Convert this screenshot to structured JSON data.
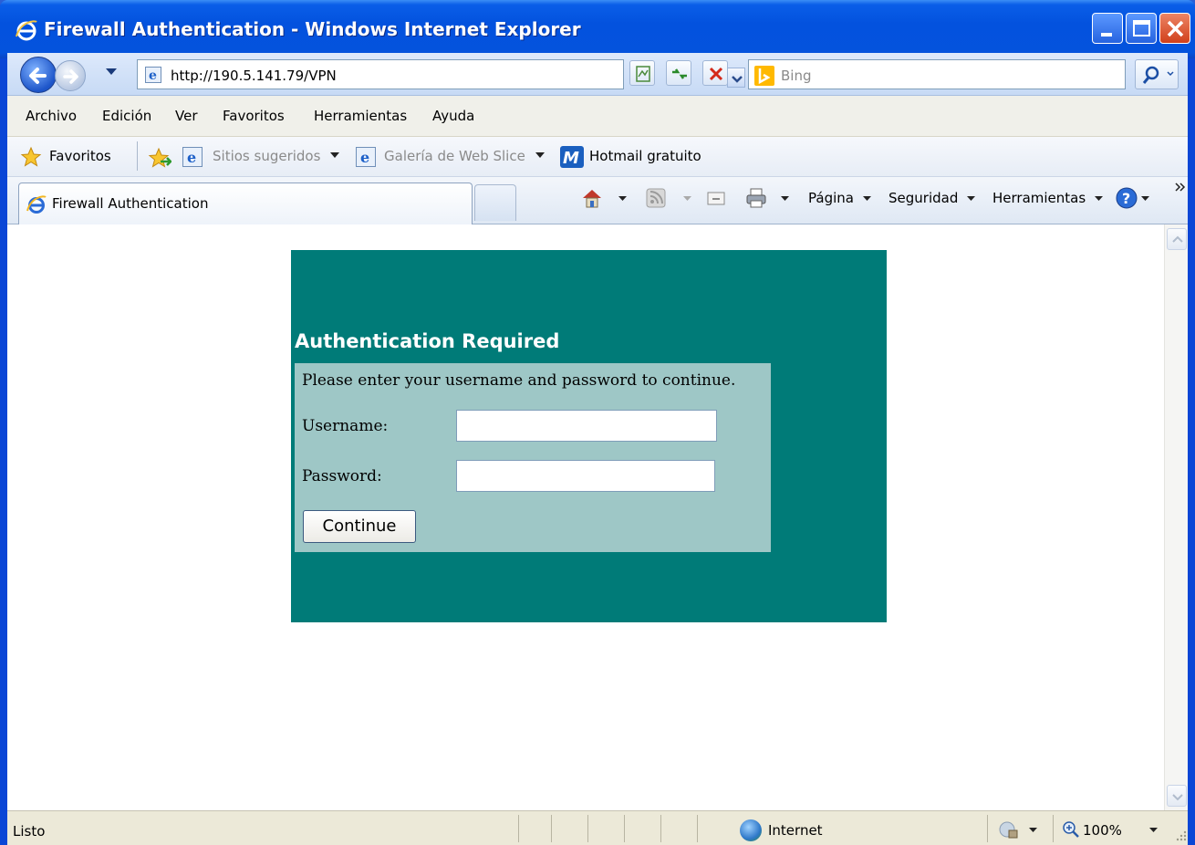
{
  "window": {
    "title": "Firewall Authentication - Windows Internet Explorer"
  },
  "addressbar": {
    "url": "http://190.5.141.79/VPN",
    "search_placeholder": "Bing"
  },
  "menubar": {
    "items": [
      "Archivo",
      "Edición",
      "Ver",
      "Favoritos",
      "Herramientas",
      "Ayuda"
    ]
  },
  "favorites_bar": {
    "favorites_label": "Favoritos",
    "suggested_sites": "Sitios sugeridos",
    "web_slice_gallery": "Galería de Web Slice",
    "hotmail": "Hotmail gratuito"
  },
  "tabs": {
    "active_tab_label": "Firewall Authentication"
  },
  "command_bar": {
    "page": "Página",
    "security": "Seguridad",
    "tools": "Herramientas"
  },
  "auth": {
    "heading": "Authentication Required",
    "instructions": "Please enter your username and password to continue.",
    "username_label": "Username:",
    "password_label": "Password:",
    "username_value": "",
    "password_value": "",
    "continue_label": "Continue"
  },
  "statusbar": {
    "status": "Listo",
    "zone": "Internet",
    "zoom": "100%"
  },
  "icons": {
    "ie": "ie-logo-icon",
    "back": "back-arrow-icon",
    "forward": "forward-arrow-icon",
    "compat": "compatibility-view-icon",
    "refresh": "refresh-icon",
    "stop": "stop-icon",
    "search": "search-icon",
    "favorites_star": "favorites-star-icon",
    "add_favorites": "add-favorites-icon",
    "home": "home-icon",
    "feeds": "feeds-icon",
    "mail": "read-mail-icon",
    "print": "print-icon",
    "help": "help-icon",
    "globe": "globe-icon",
    "zoom": "zoom-icon"
  },
  "colors": {
    "panel_background": "#007b78",
    "form_background": "#9ec7c6",
    "title_bar": "#0453dd"
  }
}
